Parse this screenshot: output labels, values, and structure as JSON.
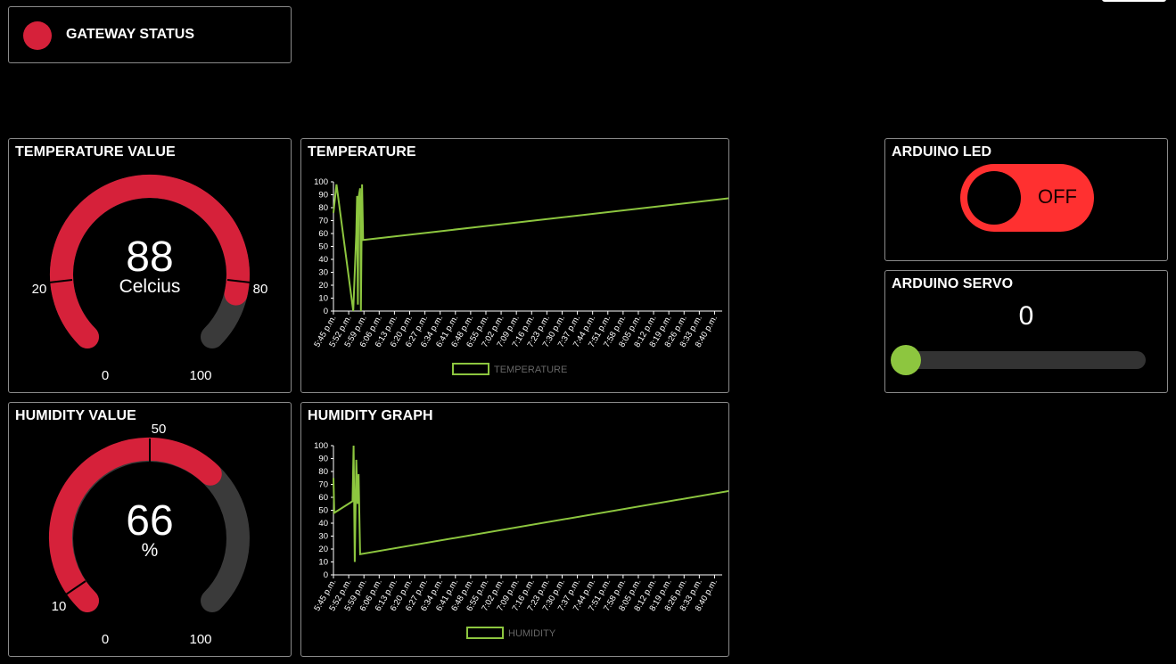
{
  "gateway": {
    "label": "GATEWAY STATUS",
    "status_color": "#d6213a"
  },
  "temperature_gauge": {
    "title": "TEMPERATURE VALUE",
    "value": "88",
    "value_num": 88,
    "unit": "Celcius",
    "min": 0,
    "max": 100,
    "min_label": "0",
    "max_label": "100",
    "tick_low": "20",
    "tick_high": "80",
    "fill_color": "#d6213a",
    "track_color": "#3a3a3a"
  },
  "humidity_gauge": {
    "title": "HUMIDITY VALUE",
    "value": "66",
    "value_num": 66,
    "unit": "%",
    "min": 0,
    "max": 100,
    "min_label": "0",
    "max_label": "100",
    "tick_low": "10",
    "tick_mid": "50",
    "fill_color": "#d6213a",
    "track_color": "#3a3a3a"
  },
  "temperature_chart": {
    "title": "TEMPERATURE",
    "legend": "TEMPERATURE",
    "chart_data": {
      "type": "line",
      "ylim": [
        0,
        100
      ],
      "yticks": [
        "0",
        "10",
        "20",
        "30",
        "40",
        "50",
        "60",
        "70",
        "80",
        "90",
        "100"
      ],
      "xticks": [
        "5:45 p.m.",
        "5:52 p.m.",
        "5:59 p.m.",
        "6:06 p.m.",
        "6:13 p.m.",
        "6:20 p.m.",
        "6:27 p.m.",
        "6:34 p.m.",
        "6:41 p.m.",
        "6:48 p.m.",
        "6:55 p.m.",
        "7:02 p.m.",
        "7:09 p.m.",
        "7:16 p.m.",
        "7:23 p.m.",
        "7:30 p.m.",
        "7:37 p.m.",
        "7:44 p.m.",
        "7:51 p.m.",
        "7:58 p.m.",
        "8:05 p.m.",
        "8:12 p.m.",
        "8:19 p.m.",
        "8:26 p.m.",
        "8:33 p.m.",
        "8:40 p.m."
      ],
      "series": [
        {
          "name": "TEMPERATURE",
          "color": "#8dc63f",
          "points": [
            [
              0,
              76
            ],
            [
              0.2,
              98
            ],
            [
              1.3,
              0
            ],
            [
              1.5,
              60
            ],
            [
              1.55,
              89
            ],
            [
              1.6,
              5
            ],
            [
              1.65,
              88
            ],
            [
              1.75,
              95
            ],
            [
              1.8,
              0
            ],
            [
              1.88,
              98
            ],
            [
              1.95,
              55
            ],
            [
              26.5,
              88
            ]
          ]
        }
      ]
    }
  },
  "humidity_chart": {
    "title": "HUMIDITY GRAPH",
    "legend": "HUMIDITY",
    "chart_data": {
      "type": "line",
      "ylim": [
        0,
        100
      ],
      "yticks": [
        "0",
        "10",
        "20",
        "30",
        "40",
        "50",
        "60",
        "70",
        "80",
        "90",
        "100"
      ],
      "xticks": [
        "5:45 p.m.",
        "5:52 p.m.",
        "5:59 p.m.",
        "6:06 p.m.",
        "6:13 p.m.",
        "6:20 p.m.",
        "6:27 p.m.",
        "6:34 p.m.",
        "6:41 p.m.",
        "6:48 p.m.",
        "6:55 p.m.",
        "7:02 p.m.",
        "7:09 p.m.",
        "7:16 p.m.",
        "7:23 p.m.",
        "7:30 p.m.",
        "7:37 p.m.",
        "7:44 p.m.",
        "7:51 p.m.",
        "7:58 p.m.",
        "8:05 p.m.",
        "8:12 p.m.",
        "8:19 p.m.",
        "8:26 p.m.",
        "8:33 p.m.",
        "8:40 p.m."
      ],
      "series": [
        {
          "name": "HUMIDITY",
          "color": "#8dc63f",
          "points": [
            [
              0,
              75
            ],
            [
              0.05,
              48
            ],
            [
              1.25,
              57
            ],
            [
              1.32,
              100
            ],
            [
              1.4,
              10
            ],
            [
              1.5,
              89
            ],
            [
              1.58,
              55
            ],
            [
              1.65,
              78
            ],
            [
              1.75,
              16
            ],
            [
              26.5,
              66
            ]
          ]
        }
      ]
    }
  },
  "led": {
    "title": "ARDUINO LED",
    "state_label": "OFF",
    "on_color": "#ff3030"
  },
  "servo": {
    "title": "ARDUINO SERVO",
    "value": "0",
    "value_num": 0,
    "min": 0,
    "max": 180,
    "thumb_color": "#8dc63f"
  }
}
